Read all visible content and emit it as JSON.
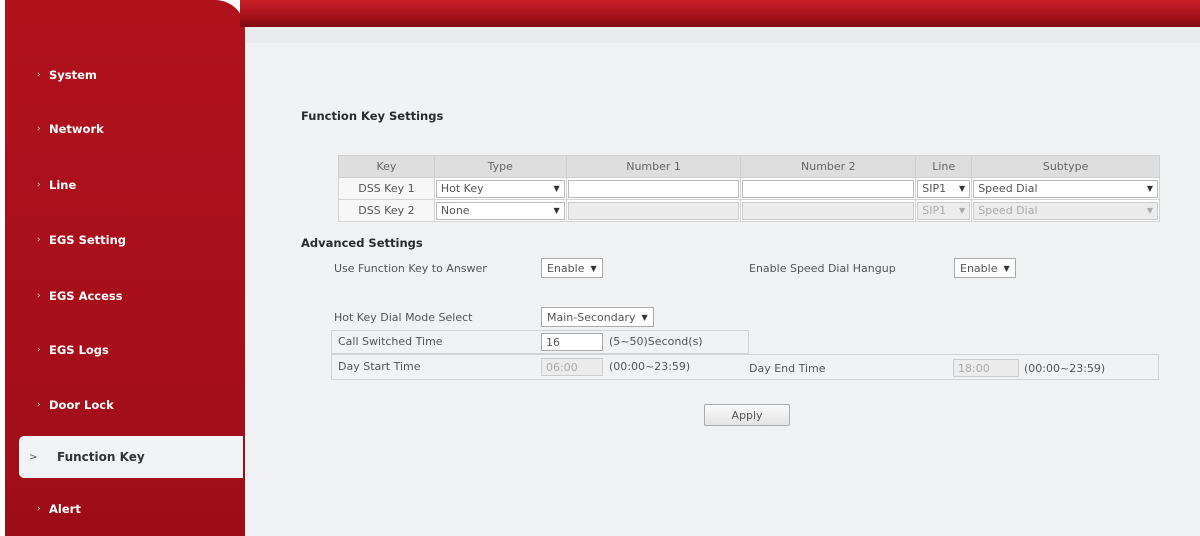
{
  "sidebar": {
    "items": [
      {
        "label": "System",
        "bullet": "›"
      },
      {
        "label": "Network",
        "bullet": "›"
      },
      {
        "label": "Line",
        "bullet": "›"
      },
      {
        "label": "EGS Setting",
        "bullet": "›"
      },
      {
        "label": "EGS Access",
        "bullet": "›"
      },
      {
        "label": "EGS Logs",
        "bullet": "›"
      },
      {
        "label": "Door Lock",
        "bullet": "›"
      },
      {
        "label": "Function Key",
        "bullet": ">",
        "active": true
      },
      {
        "label": "Alert",
        "bullet": "›"
      }
    ]
  },
  "function_key": {
    "title": "Function Key Settings",
    "headers": [
      "Key",
      "Type",
      "Number 1",
      "Number 2",
      "Line",
      "Subtype"
    ],
    "rows": [
      {
        "key": "DSS Key 1",
        "type": "Hot Key",
        "number1": "",
        "number2": "",
        "line": "SIP1",
        "subtype": "Speed Dial",
        "disabled": false
      },
      {
        "key": "DSS Key 2",
        "type": "None",
        "number1": "",
        "number2": "",
        "line": "SIP1",
        "subtype": "Speed Dial",
        "disabled": true
      }
    ]
  },
  "advanced": {
    "title": "Advanced Settings",
    "use_fk_answer_label": "Use Function Key to Answer",
    "use_fk_answer_value": "Enable",
    "speed_dial_hangup_label": "Enable Speed Dial Hangup",
    "speed_dial_hangup_value": "Enable",
    "hot_key_mode_label": "Hot Key Dial Mode Select",
    "hot_key_mode_value": "Main-Secondary",
    "call_switched_label": "Call Switched Time",
    "call_switched_value": "16",
    "call_switched_hint": "(5~50)Second(s)",
    "day_start_label": "Day Start Time",
    "day_start_value": "06:00",
    "day_start_hint": "(00:00~23:59)",
    "day_end_label": "Day End Time",
    "day_end_value": "18:00",
    "day_end_hint": "(00:00~23:59)"
  },
  "apply_label": "Apply",
  "icons": {
    "dropdown": "▼"
  },
  "colors": {
    "sidebar": "#a80f1b",
    "header": "#9e0f19",
    "content_bg": "#f0f2f4"
  }
}
